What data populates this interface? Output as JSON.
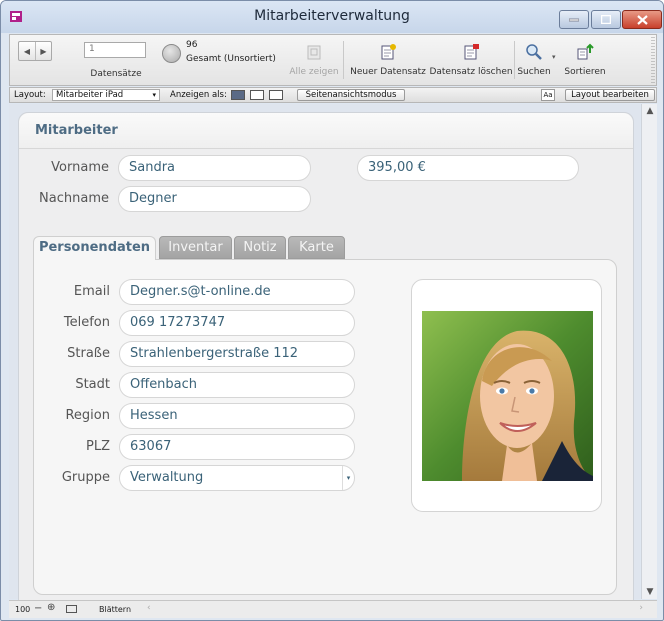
{
  "window": {
    "title": "Mitarbeiterverwaltung"
  },
  "toolbar": {
    "record_number": "1",
    "records_label": "Datensätze",
    "total_count": "96",
    "total_label": "Gesamt (Unsortiert)",
    "show_all": "Alle zeigen",
    "new_record": "Neuer Datensatz",
    "delete_record": "Datensatz löschen",
    "search": "Suchen",
    "sort": "Sortieren"
  },
  "layoutbar": {
    "layout_label": "Layout:",
    "layout_value": "Mitarbeiter iPad",
    "view_as_label": "Anzeigen als:",
    "preview_mode": "Seitenansichtsmodus",
    "text_size": "Aa",
    "edit_layout": "Layout bearbeiten"
  },
  "record": {
    "section_title": "Mitarbeiter",
    "first_name_label": "Vorname",
    "first_name": "Sandra",
    "last_name_label": "Nachname",
    "last_name": "Degner",
    "amount": "395,00 €"
  },
  "tabs": {
    "personal": "Personendaten",
    "inventory": "Inventar",
    "note": "Notiz",
    "map": "Karte"
  },
  "details": {
    "email_label": "Email",
    "email": "Degner.s@t-online.de",
    "phone_label": "Telefon",
    "phone": "069 17273747",
    "street_label": "Straße",
    "street": "Strahlenbergerstraße 112",
    "city_label": "Stadt",
    "city": "Offenbach",
    "region_label": "Region",
    "region": "Hessen",
    "zip_label": "PLZ",
    "zip": "63067",
    "group_label": "Gruppe",
    "group": "Verwaltung"
  },
  "statusbar": {
    "zoom": "100",
    "mode": "Blättern"
  },
  "colors": {
    "accent": "#4e6c84",
    "field_text": "#3a6278",
    "close_button": "#c8402c"
  }
}
